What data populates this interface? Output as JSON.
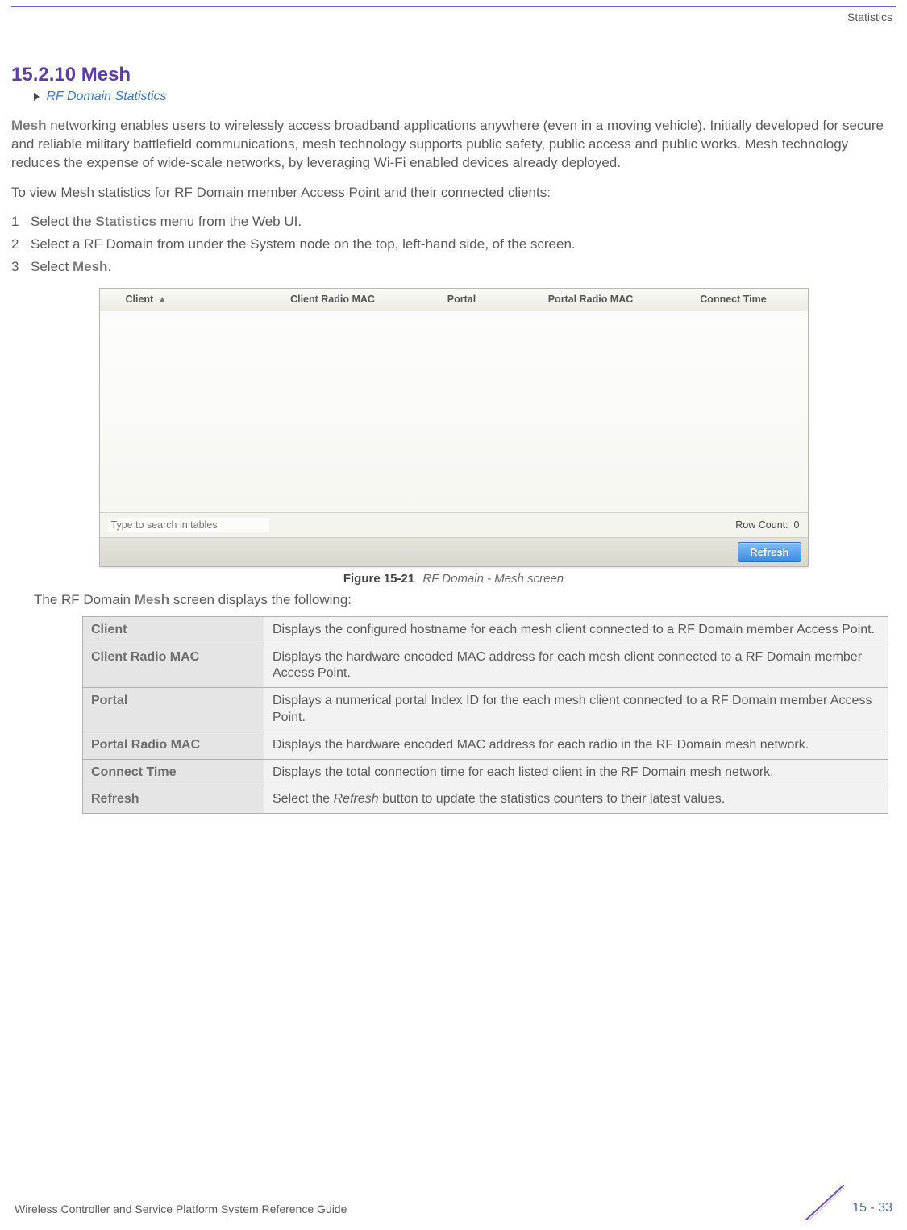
{
  "header": {
    "right_label": "Statistics"
  },
  "section": {
    "number_title": "15.2.10 Mesh",
    "sublink": "RF Domain Statistics"
  },
  "paragraphs": {
    "intro_mesh": "Mesh",
    "intro_rest": " networking enables users to wirelessly access broadband applications anywhere (even in a moving vehicle). Initially developed for secure and reliable military battlefield communications, mesh technology supports public safety, public access and public works. Mesh technology reduces the expense of wide-scale networks, by leveraging Wi-Fi enabled devices already deployed.",
    "lead": "To view Mesh statistics for RF Domain member Access Point and their connected clients:"
  },
  "steps": {
    "s1_a": "Select the ",
    "s1_b": "Statistics",
    "s1_c": " menu from the Web UI.",
    "s2": "Select a RF Domain from under the System node on the top, left-hand side, of the screen.",
    "s3_a": "Select ",
    "s3_b": "Mesh",
    "s3_c": "."
  },
  "screenshot": {
    "columns": {
      "c1": "Client",
      "c2": "Client Radio MAC",
      "c3": "Portal",
      "c4": "Portal Radio MAC",
      "c5": "Connect Time"
    },
    "search_placeholder": "Type to search in tables",
    "row_count_label": "Row Count:",
    "row_count_value": "0",
    "refresh_label": "Refresh"
  },
  "figure": {
    "label": "Figure 15-21",
    "title": "RF Domain - Mesh screen"
  },
  "after_fig_a": "The RF Domain ",
  "after_fig_b": "Mesh",
  "after_fig_c": " screen displays the following:",
  "table": [
    {
      "label": "Client",
      "val": "Displays the configured hostname for each mesh client connected to a RF Domain member Access Point."
    },
    {
      "label": "Client Radio MAC",
      "val": "Displays the hardware encoded MAC address for each mesh client connected to a RF Domain member Access Point."
    },
    {
      "label": "Portal",
      "val": "Displays a numerical portal Index ID for the each mesh client connected to a RF Domain member Access Point."
    },
    {
      "label": "Portal Radio MAC",
      "val": "Displays the hardware encoded MAC address for each radio in the RF Domain mesh network."
    },
    {
      "label": "Connect Time",
      "val": "Displays the total connection time for each listed client in the RF Domain mesh network."
    },
    {
      "label": "Refresh",
      "val_a": "Select the ",
      "val_i": "Refresh",
      "val_b": " button to update the statistics counters to their latest values."
    }
  ],
  "footer": {
    "left": "Wireless Controller and Service Platform System Reference Guide",
    "page": "15 - 33"
  }
}
